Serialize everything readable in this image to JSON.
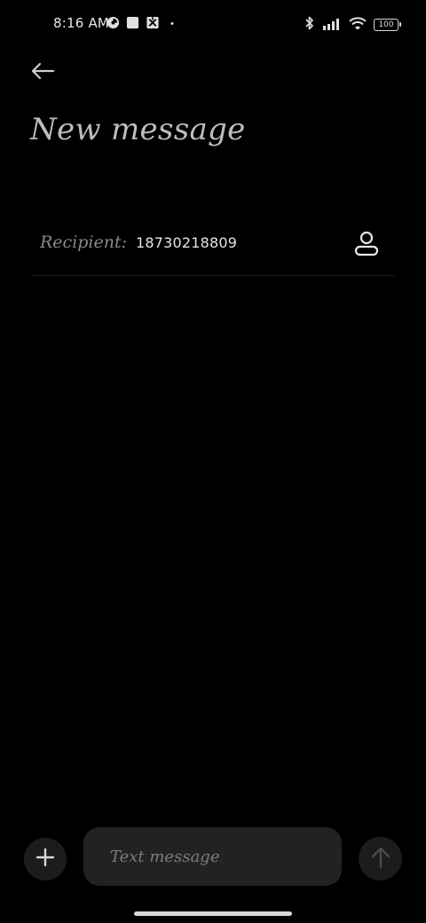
{
  "status_bar": {
    "time": "8:16 AM",
    "battery": "100",
    "left_icons": [
      "data-saver-icon",
      "square-app-icon",
      "crossed-box-icon",
      "dot-icon"
    ],
    "right_icons": [
      "bluetooth-icon",
      "signal-icon",
      "wifi-icon",
      "battery-icon"
    ]
  },
  "header": {
    "back_icon": "arrow-left-icon",
    "title": "New message"
  },
  "recipient": {
    "label": "Recipient:",
    "value": "18730218809",
    "contact_icon": "person-icon"
  },
  "composer": {
    "add_icon": "plus-icon",
    "placeholder": "Text message",
    "send_icon": "arrow-up-icon"
  },
  "colors": {
    "background": "#000000",
    "surface": "#222222",
    "button_surface": "#1c1c1c",
    "title_text": "#bdbdbd",
    "muted_text": "#8a8a8a"
  }
}
